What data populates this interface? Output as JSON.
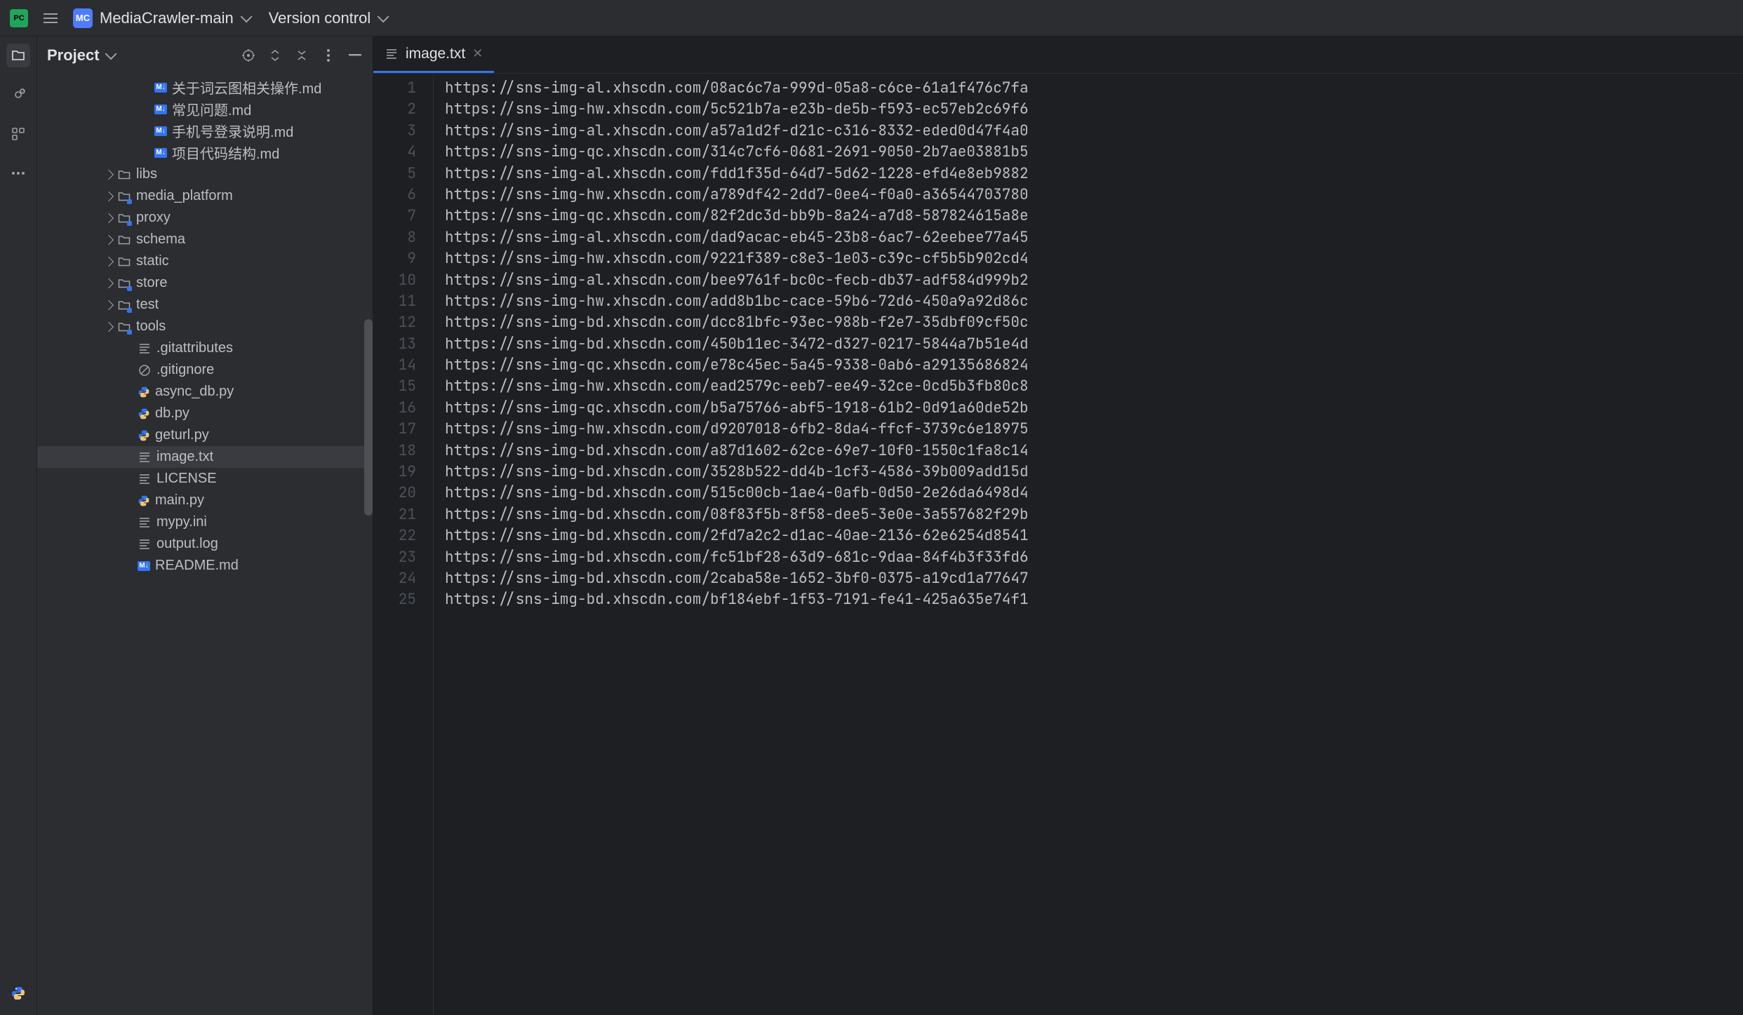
{
  "titlebar": {
    "project_badge": "MC",
    "project_name": "MediaCrawler-main",
    "vcs_label": "Version control"
  },
  "panel": {
    "title": "Project"
  },
  "tree": [
    {
      "indent": 146,
      "icon": "md",
      "label": "关于词云图相关操作.md",
      "chevron": false
    },
    {
      "indent": 146,
      "icon": "md",
      "label": "常见问题.md",
      "chevron": false
    },
    {
      "indent": 146,
      "icon": "md",
      "label": "手机号登录说明.md",
      "chevron": false
    },
    {
      "indent": 146,
      "icon": "md",
      "label": "项目代码结构.md",
      "chevron": false
    },
    {
      "indent": 97,
      "icon": "folder",
      "label": "libs",
      "chevron": true
    },
    {
      "indent": 97,
      "icon": "folder-module",
      "label": "media_platform",
      "chevron": true
    },
    {
      "indent": 97,
      "icon": "folder-module",
      "label": "proxy",
      "chevron": true
    },
    {
      "indent": 97,
      "icon": "folder",
      "label": "schema",
      "chevron": true
    },
    {
      "indent": 97,
      "icon": "folder",
      "label": "static",
      "chevron": true
    },
    {
      "indent": 97,
      "icon": "folder-module",
      "label": "store",
      "chevron": true
    },
    {
      "indent": 97,
      "icon": "folder-module",
      "label": "test",
      "chevron": true
    },
    {
      "indent": 97,
      "icon": "folder-module",
      "label": "tools",
      "chevron": true
    },
    {
      "indent": 122,
      "icon": "txt",
      "label": ".gitattributes",
      "chevron": false
    },
    {
      "indent": 122,
      "icon": "ignore",
      "label": ".gitignore",
      "chevron": false
    },
    {
      "indent": 122,
      "icon": "py",
      "label": "async_db.py",
      "chevron": false
    },
    {
      "indent": 122,
      "icon": "py",
      "label": "db.py",
      "chevron": false
    },
    {
      "indent": 122,
      "icon": "py",
      "label": "geturl.py",
      "chevron": false
    },
    {
      "indent": 122,
      "icon": "txt",
      "label": "image.txt",
      "chevron": false,
      "selected": true
    },
    {
      "indent": 122,
      "icon": "txt",
      "label": "LICENSE",
      "chevron": false
    },
    {
      "indent": 122,
      "icon": "py",
      "label": "main.py",
      "chevron": false
    },
    {
      "indent": 122,
      "icon": "txt",
      "label": "mypy.ini",
      "chevron": false
    },
    {
      "indent": 122,
      "icon": "txt",
      "label": "output.log",
      "chevron": false
    },
    {
      "indent": 122,
      "icon": "md",
      "label": "README.md",
      "chevron": false
    }
  ],
  "tabs": [
    {
      "label": "image.txt",
      "icon": "txt",
      "active": true
    }
  ],
  "editor": {
    "lines": [
      "https://sns-img-al.xhscdn.com/08ac6c7a-999d-05a8-c6ce-61a1f476c7fa",
      "https://sns-img-hw.xhscdn.com/5c521b7a-e23b-de5b-f593-ec57eb2c69f6",
      "https://sns-img-al.xhscdn.com/a57a1d2f-d21c-c316-8332-eded0d47f4a0",
      "https://sns-img-qc.xhscdn.com/314c7cf6-0681-2691-9050-2b7ae03881b5",
      "https://sns-img-al.xhscdn.com/fdd1f35d-64d7-5d62-1228-efd4e8eb9882",
      "https://sns-img-hw.xhscdn.com/a789df42-2dd7-0ee4-f0a0-a36544703780",
      "https://sns-img-qc.xhscdn.com/82f2dc3d-bb9b-8a24-a7d8-587824615a8e",
      "https://sns-img-al.xhscdn.com/dad9acac-eb45-23b8-6ac7-62eebee77a45",
      "https://sns-img-hw.xhscdn.com/9221f389-c8e3-1e03-c39c-cf5b5b902cd4",
      "https://sns-img-al.xhscdn.com/bee9761f-bc0c-fecb-db37-adf584d999b2",
      "https://sns-img-hw.xhscdn.com/add8b1bc-cace-59b6-72d6-450a9a92d86c",
      "https://sns-img-bd.xhscdn.com/dcc81bfc-93ec-988b-f2e7-35dbf09cf50c",
      "https://sns-img-bd.xhscdn.com/450b11ec-3472-d327-0217-5844a7b51e4d",
      "https://sns-img-qc.xhscdn.com/e78c45ec-5a45-9338-0ab6-a29135686824",
      "https://sns-img-hw.xhscdn.com/ead2579c-eeb7-ee49-32ce-0cd5b3fb80c8",
      "https://sns-img-qc.xhscdn.com/b5a75766-abf5-1918-61b2-0d91a60de52b",
      "https://sns-img-hw.xhscdn.com/d9207018-6fb2-8da4-ffcf-3739c6e18975",
      "https://sns-img-bd.xhscdn.com/a87d1602-62ce-69e7-10f0-1550c1fa8c14",
      "https://sns-img-bd.xhscdn.com/3528b522-dd4b-1cf3-4586-39b009add15d",
      "https://sns-img-bd.xhscdn.com/515c00cb-1ae4-0afb-0d50-2e26da6498d4",
      "https://sns-img-bd.xhscdn.com/08f83f5b-8f58-dee5-3e0e-3a557682f29b",
      "https://sns-img-bd.xhscdn.com/2fd7a2c2-d1ac-40ae-2136-62e6254d8541",
      "https://sns-img-bd.xhscdn.com/fc51bf28-63d9-681c-9daa-84f4b3f33fd6",
      "https://sns-img-bd.xhscdn.com/2caba58e-1652-3bf0-0375-a19cd1a77647",
      "https://sns-img-bd.xhscdn.com/bf184ebf-1f53-7191-fe41-425a635e74f1"
    ]
  }
}
